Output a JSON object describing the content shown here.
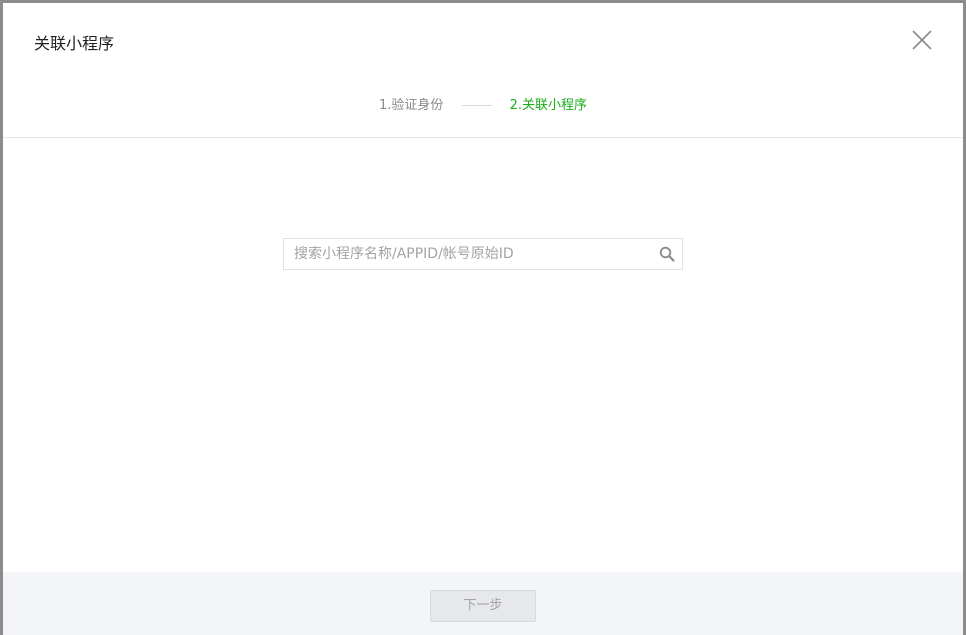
{
  "dialog": {
    "title": "关联小程序",
    "close_icon": "close-icon"
  },
  "steps": {
    "step1_label": "1.验证身份",
    "step2_label": "2.关联小程序",
    "active_color": "#1aad19",
    "inactive_color": "#8a8a8a"
  },
  "search": {
    "value": "",
    "placeholder": "搜索小程序名称/APPID/帐号原始ID",
    "icon": "search-icon"
  },
  "footer": {
    "next_label": "下一步"
  }
}
